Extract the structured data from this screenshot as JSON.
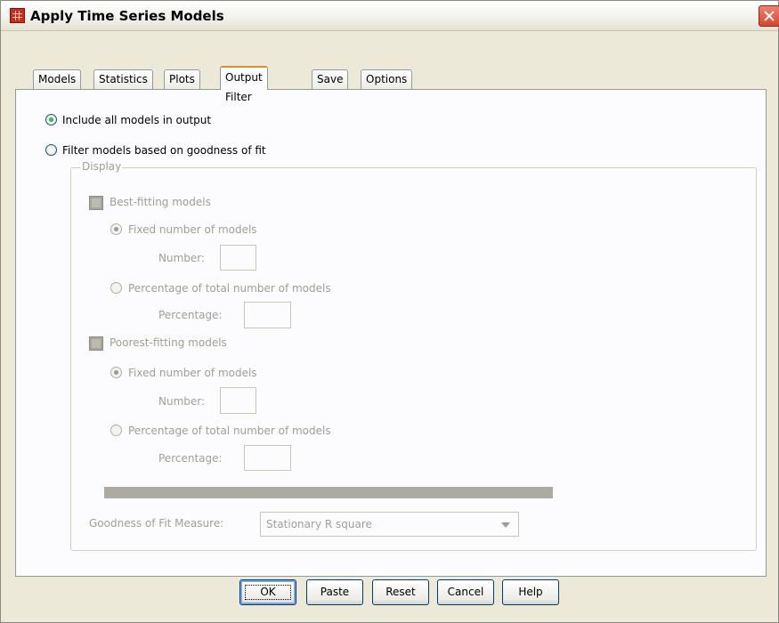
{
  "window": {
    "title": "Apply Time Series Models"
  },
  "tabs": [
    {
      "label": "Models",
      "active": false
    },
    {
      "label": "Statistics",
      "active": false
    },
    {
      "label": "Plots",
      "active": false
    },
    {
      "label": "Output Filter",
      "active": true
    },
    {
      "label": "Save",
      "active": false
    },
    {
      "label": "Options",
      "active": false
    }
  ],
  "output_filter": {
    "include_all": {
      "label": "Include all models in output",
      "selected": true
    },
    "filter_by_fit": {
      "label": "Filter models based on goodness of fit",
      "selected": false
    },
    "display": {
      "legend": "Display",
      "best_fitting": {
        "label": "Best-fitting models",
        "checked": false,
        "enabled": false,
        "fixed": {
          "label": "Fixed number of models",
          "selected": true
        },
        "number_label": "Number:",
        "number_value": "",
        "percentage": {
          "label": "Percentage of total number of models",
          "selected": false
        },
        "percentage_label": "Percentage:",
        "percentage_value": ""
      },
      "poorest_fitting": {
        "label": "Poorest-fitting models",
        "checked": false,
        "enabled": false,
        "fixed": {
          "label": "Fixed number of models",
          "selected": true
        },
        "number_label": "Number:",
        "number_value": "",
        "percentage": {
          "label": "Percentage of total number of models",
          "selected": false
        },
        "percentage_label": "Percentage:",
        "percentage_value": ""
      }
    },
    "fit_measure": {
      "label": "Goodness of Fit Measure:",
      "value": "Stationary R square"
    }
  },
  "buttons": {
    "ok": "OK",
    "paste": "Paste",
    "reset": "Reset",
    "cancel": "Cancel",
    "help": "Help"
  },
  "colors": {
    "accent_tab": "#e68b2c",
    "radio_selected": "#21a121",
    "close": "#d9442c"
  }
}
